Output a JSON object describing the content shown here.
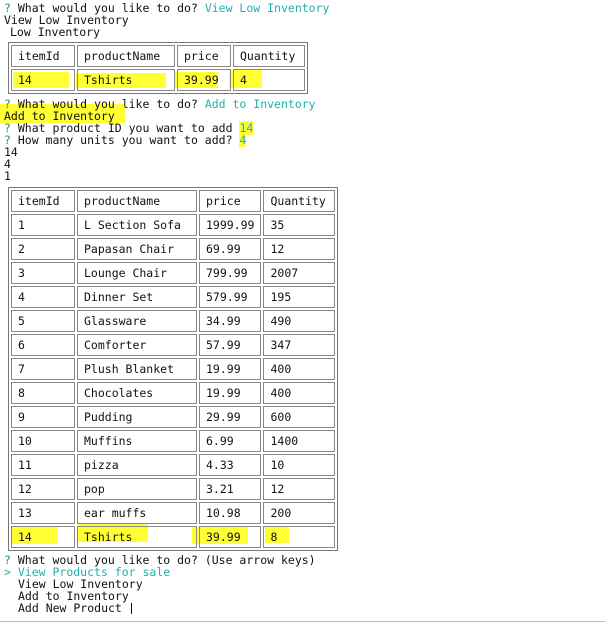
{
  "session": {
    "prompt_mark": "?",
    "select_mark": ">",
    "q1": {
      "question": " What would you like to do?",
      "answer": "View Low Inventory"
    },
    "echo1": "View Low Inventory",
    "title1": "Low Inventory",
    "q2": {
      "question": " What would you like to do?",
      "answer": "Add to Inventory"
    },
    "echo2": "Add to Inventory",
    "q3": {
      "question": " What product ID you want to add",
      "answer": "14"
    },
    "q4": {
      "question": " How many units you want to add?",
      "answer": "4"
    },
    "out1": "14",
    "out2": "4",
    "out3": "1",
    "q5": {
      "question": " What would you like to do?",
      "hint": "(Use arrow keys)"
    },
    "menu": {
      "selected": "View Products for sale",
      "items": [
        "View Low Inventory",
        "Add to Inventory",
        "Add New Product"
      ]
    }
  },
  "low_table": {
    "headers": [
      "itemId",
      "productName",
      "price",
      "Quantity"
    ],
    "rows": [
      [
        "14",
        "Tshirts",
        "39.99",
        "4"
      ]
    ]
  },
  "inv_table": {
    "headers": [
      "itemId",
      "productName",
      "price",
      "Quantity"
    ],
    "rows": [
      [
        "1",
        "L Section Sofa",
        "1999.99",
        "35"
      ],
      [
        "2",
        "Papasan Chair",
        "69.99",
        "12"
      ],
      [
        "3",
        "Lounge Chair",
        "799.99",
        "2007"
      ],
      [
        "4",
        "Dinner Set",
        "579.99",
        "195"
      ],
      [
        "5",
        "Glassware",
        "34.99",
        "490"
      ],
      [
        "6",
        "Comforter",
        "57.99",
        "347"
      ],
      [
        "7",
        "Plush Blanket",
        "19.99",
        "400"
      ],
      [
        "8",
        "Chocolates",
        "19.99",
        "400"
      ],
      [
        "9",
        "Pudding",
        "29.99",
        "600"
      ],
      [
        "10",
        "Muffins",
        "6.99",
        "1400"
      ],
      [
        "11",
        "pizza",
        "4.33",
        "10"
      ],
      [
        "12",
        "pop",
        "3.21",
        "12"
      ],
      [
        "13",
        "ear muffs",
        "10.98",
        "200"
      ],
      [
        "14",
        "Tshirts",
        "39.99",
        "8"
      ]
    ]
  },
  "colors": {
    "prompt": "#2e8b57",
    "answer": "#20b2aa",
    "highlight": "#ffff33"
  }
}
